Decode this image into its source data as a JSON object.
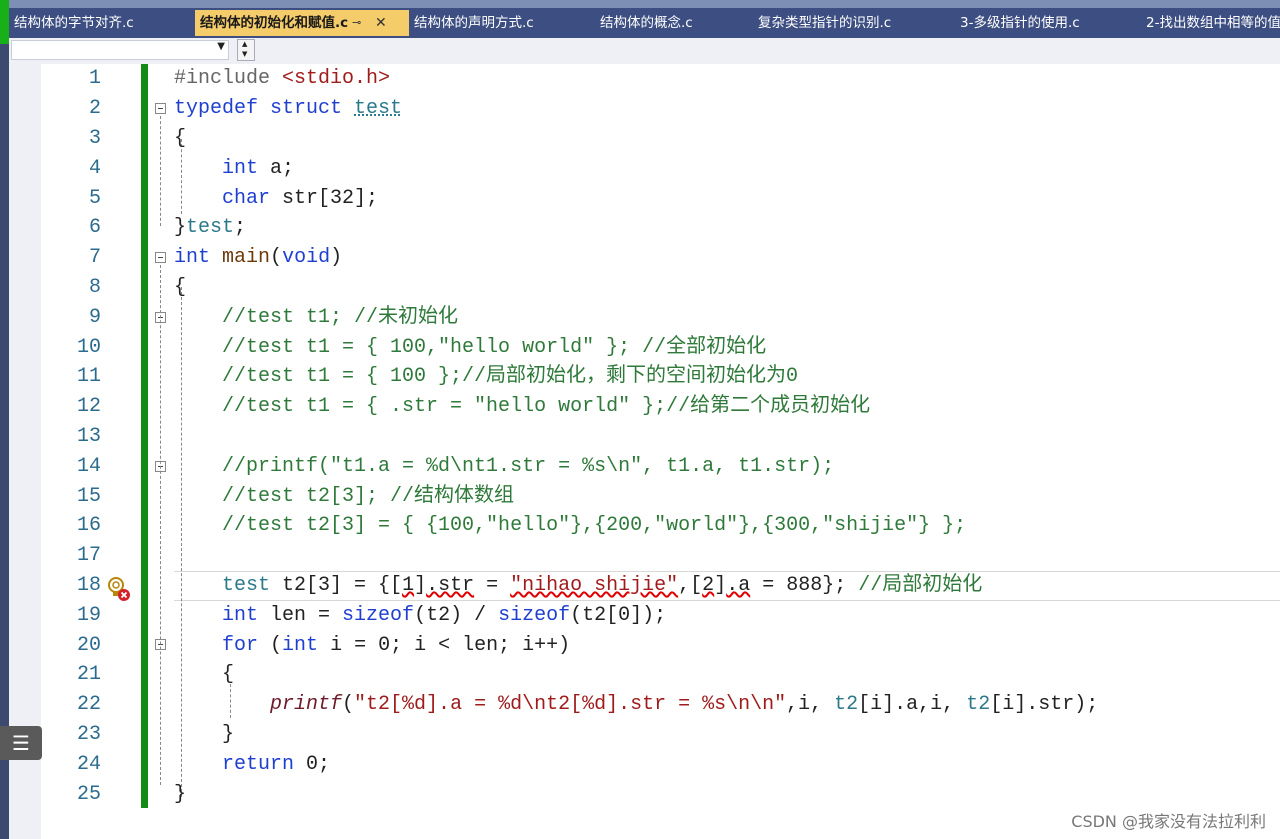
{
  "tabs": [
    {
      "label": "结构体的字节对齐.c",
      "active": false
    },
    {
      "label": "结构体的初始化和赋值.c",
      "active": true
    },
    {
      "label": "结构体的声明方式.c",
      "active": false
    },
    {
      "label": "结构体的概念.c",
      "active": false
    },
    {
      "label": "复杂类型指针的识别.c",
      "active": false
    },
    {
      "label": "3-多级指针的使用.c",
      "active": false
    },
    {
      "label": "2-找出数组中相等的值",
      "active": false
    }
  ],
  "tab_pin_glyph": "⊸",
  "tab_close_glyph": "✕",
  "navbar": {
    "scope_value": ""
  },
  "line_numbers": [
    "1",
    "2",
    "3",
    "4",
    "5",
    "6",
    "7",
    "8",
    "9",
    "10",
    "11",
    "12",
    "13",
    "14",
    "15",
    "16",
    "17",
    "18",
    "19",
    "20",
    "21",
    "22",
    "23",
    "24",
    "25"
  ],
  "code": {
    "l1": {
      "a": "#include ",
      "b": "<stdio.h>"
    },
    "l2": {
      "a": "typedef struct ",
      "b": "test"
    },
    "l3": "{",
    "l4": {
      "a": "int",
      "b": " a;"
    },
    "l5": {
      "a": "char",
      "b": " str[32];"
    },
    "l6": {
      "a": "}",
      "b": "test",
      "c": ";"
    },
    "l7": {
      "a": "int",
      "b": " ",
      "c": "main",
      "d": "(",
      "e": "void",
      "f": ")"
    },
    "l8": "{",
    "l9": "//test t1; //未初始化",
    "l10": "//test t1 = { 100,\"hello world\" }; //全部初始化",
    "l11": "//test t1 = { 100 };//局部初始化，剩下的空间初始化为0",
    "l12": "//test t1 = { .str = \"hello world\" };//给第二个成员初始化",
    "l14": "//printf(\"t1.a = %d\\nt1.str = %s\\n\", t1.a, t1.str);",
    "l15": "//test t2[3]; //结构体数组",
    "l16": "//test t2[3] = { {100,\"hello\"},{200,\"world\"},{300,\"shijie\"} };",
    "l18": {
      "a": "test",
      "b": " t2[3] = {[",
      "c": "1",
      "d": "]",
      "e": ".str",
      "f": " = ",
      "g": "\"nihao shijie\"",
      "h": ",[",
      "i": "2",
      "j": "]",
      "k": ".a",
      "l": " = 888}; ",
      "m": "//局部初始化"
    },
    "l19": {
      "a": "int",
      "b": " len = ",
      "c": "sizeof",
      "d": "(t2) / ",
      "e": "sizeof",
      "f": "(t2[0]);"
    },
    "l20": {
      "a": "for",
      "b": " (",
      "c": "int",
      "d": " i = 0; i < len; i++)"
    },
    "l21": "{",
    "l22": {
      "a": "printf",
      "b": "(",
      "c": "\"t2[%d].a = %d\\nt2[%d].str = %s\\n\\n\"",
      "d": ",i, ",
      "e": "t2",
      "f": "[i].a,i, ",
      "g": "t2",
      "h": "[i].str);"
    },
    "l23": "}",
    "l24": {
      "a": "return",
      "b": " 0;"
    },
    "l25": "}"
  },
  "list_button_glyph": "☰",
  "watermark": "CSDN @我家没有法拉利利"
}
